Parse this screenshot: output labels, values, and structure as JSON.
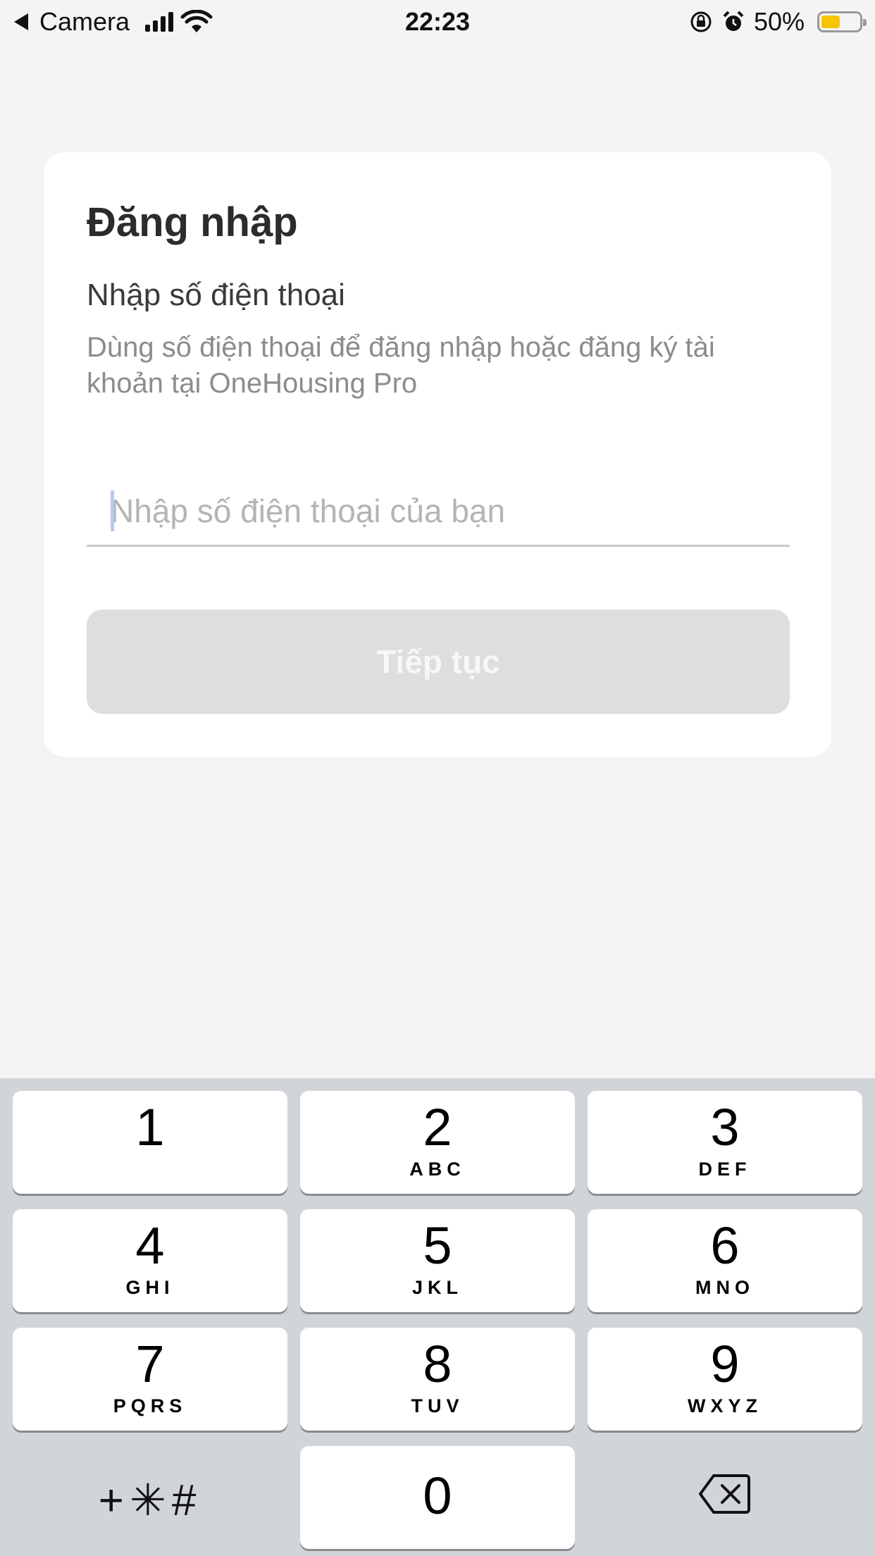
{
  "status_bar": {
    "back_app": "Camera",
    "time": "22:23",
    "battery_percent": "50%",
    "battery_level": 0.5,
    "icons": [
      "back-arrow-icon",
      "cellular-signal-icon",
      "wifi-icon",
      "orientation-lock-icon",
      "alarm-icon",
      "battery-icon"
    ]
  },
  "login": {
    "title": "Đăng nhập",
    "subtitle": "Nhập số điện thoại",
    "description": "Dùng số điện thoại để đăng nhập hoặc đăng ký tài khoản tại OneHousing Pro",
    "phone_placeholder": "Nhập số điện thoại của bạn",
    "phone_value": "",
    "continue_label": "Tiếp tục",
    "continue_enabled": false
  },
  "keypad": {
    "keys": [
      {
        "num": "1",
        "letters": ""
      },
      {
        "num": "2",
        "letters": "ABC"
      },
      {
        "num": "3",
        "letters": "DEF"
      },
      {
        "num": "4",
        "letters": "GHI"
      },
      {
        "num": "5",
        "letters": "JKL"
      },
      {
        "num": "6",
        "letters": "MNO"
      },
      {
        "num": "7",
        "letters": "PQRS"
      },
      {
        "num": "8",
        "letters": "TUV"
      },
      {
        "num": "9",
        "letters": "WXYZ"
      },
      {
        "num": "0",
        "letters": ""
      }
    ],
    "symbols_label": "+✳#",
    "delete_icon": "backspace-icon"
  }
}
